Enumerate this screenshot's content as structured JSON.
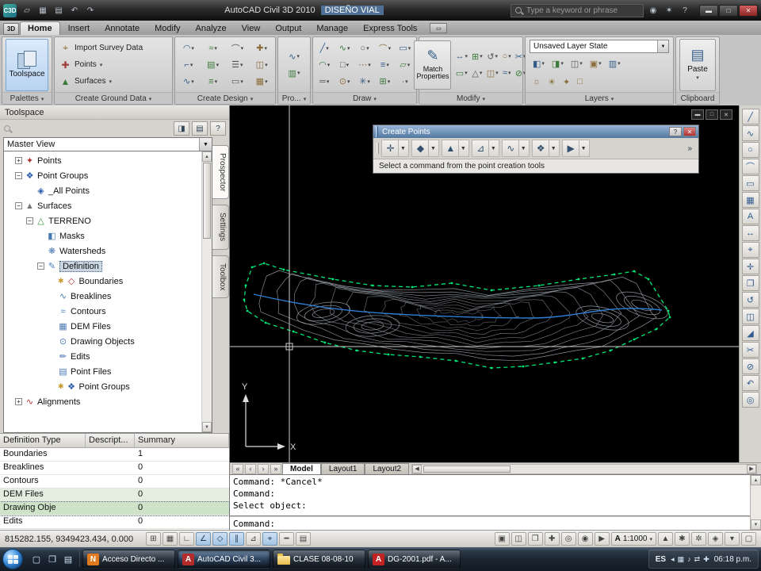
{
  "titlebar": {
    "app_title": "AutoCAD Civil 3D 2010",
    "doc_title": "DISEÑO VIAL",
    "search_placeholder": "Type a keyword or phrase",
    "quick_access": [
      {
        "name": "open-icon",
        "g": "▱"
      },
      {
        "name": "save-icon",
        "g": "▦"
      },
      {
        "name": "plot-icon",
        "g": "▤"
      },
      {
        "name": "undo-icon",
        "g": "↶"
      },
      {
        "name": "redo-icon",
        "g": "↷"
      }
    ],
    "right_icons": [
      {
        "name": "communication-center-icon",
        "g": "◉"
      },
      {
        "name": "favorites-icon",
        "g": "✶"
      },
      {
        "name": "help-icon",
        "g": "?"
      }
    ],
    "window_controls": [
      {
        "name": "minimize-button",
        "g": "▬"
      },
      {
        "name": "restore-button",
        "g": "□"
      },
      {
        "name": "close-button",
        "g": "✕"
      }
    ]
  },
  "menu": {
    "app_button": "3D",
    "tabs": [
      "Home",
      "Insert",
      "Annotate",
      "Modify",
      "Analyze",
      "View",
      "Output",
      "Manage",
      "Express Tools"
    ],
    "active_index": 0,
    "overflow_icon": "▭"
  },
  "ribbon": {
    "panels": {
      "palettes": "Palettes",
      "ground": "Create Ground Data",
      "design": "Create Design",
      "profile": "Pro...",
      "draw": "Draw",
      "modify": "Modify",
      "layers": "Layers",
      "clipboard": "Clipboard"
    },
    "toolspace_button": "Toolspace",
    "ground_buttons": [
      {
        "label": "Import Survey Data",
        "g": "⌖",
        "c": "#8a6d3b",
        "dd": false
      },
      {
        "label": "Points",
        "g": "✚",
        "c": "#a33a3a",
        "dd": true
      },
      {
        "label": "Surfaces",
        "g": "▲",
        "c": "#3a7a3a",
        "dd": true
      }
    ],
    "create_design_icons": [
      "◠",
      "≈",
      "⌒",
      "✚",
      "⌐",
      "▤",
      "☰",
      "◫",
      "∿",
      "≡",
      "▭",
      "▦"
    ],
    "profile_icons": [
      "∿",
      "▥"
    ],
    "draw_icons": [
      "╱",
      "∿",
      "○",
      "⌒",
      "▭",
      "◠",
      "□",
      "⋯",
      "≡",
      "▱",
      "═",
      "⊙",
      "✳",
      "⊞",
      "∙"
    ],
    "modify_big": "Match Properties",
    "modify_big_icon": "✎",
    "modify_icons": [
      "↔",
      "⊞",
      "↺",
      "○",
      "✂",
      "▭",
      "△",
      "◫",
      "≈",
      "⊘"
    ],
    "layers_dropdown": "Unsaved Layer State",
    "layer_tool_icons": [
      "◧",
      "◨",
      "◫",
      "▣",
      "▥"
    ],
    "layer_bulb_icons": [
      "☼",
      "☀",
      "✦",
      "□"
    ],
    "paste_button": "Paste",
    "paste_icon": "▤"
  },
  "toolspace": {
    "title": "Toolspace",
    "header_icons": [
      {
        "name": "autohide-icon",
        "g": "◨"
      },
      {
        "name": "properties-icon",
        "g": "▤"
      },
      {
        "name": "help-icon",
        "g": "?"
      }
    ],
    "view_selector": "Master View",
    "side_tabs": [
      "Prospector",
      "Settings",
      "Toolbox"
    ],
    "tree": [
      {
        "label": "Points",
        "lvl": 1,
        "exp": "+",
        "icon": "points-icon",
        "g": "✦",
        "c": "#b03030"
      },
      {
        "label": "Point Groups",
        "lvl": 1,
        "exp": "-",
        "icon": "point-groups-icon",
        "g": "❖",
        "c": "#2a5caa"
      },
      {
        "label": "_All Points",
        "lvl": 2,
        "exp": "",
        "icon": "point-group-icon",
        "g": "◈",
        "c": "#2a5caa"
      },
      {
        "label": "Surfaces",
        "lvl": 1,
        "exp": "-",
        "icon": "surfaces-icon",
        "g": "▲",
        "c": "#777777"
      },
      {
        "label": "TERRENO",
        "lvl": 2,
        "exp": "-",
        "icon": "surface-icon",
        "g": "△",
        "c": "#3a8f3a"
      },
      {
        "label": "Masks",
        "lvl": 3,
        "exp": "",
        "icon": "masks-icon",
        "g": "◧",
        "c": "#4a7ab5"
      },
      {
        "label": "Watersheds",
        "lvl": 3,
        "exp": "",
        "icon": "watersheds-icon",
        "g": "❋",
        "c": "#4a7ab5"
      },
      {
        "label": "Definition",
        "lvl": 3,
        "exp": "-",
        "icon": "definition-icon",
        "g": "✎",
        "c": "#4a7ab5",
        "sel": true
      },
      {
        "label": "Boundaries",
        "lvl": 4,
        "exp": "",
        "icon": "boundaries-icon",
        "g": "◇",
        "c": "#b03030",
        "star": true
      },
      {
        "label": "Breaklines",
        "lvl": 4,
        "exp": "",
        "icon": "breaklines-icon",
        "g": "∿",
        "c": "#4a7ab5"
      },
      {
        "label": "Contours",
        "lvl": 4,
        "exp": "",
        "icon": "contours-icon",
        "g": "≈",
        "c": "#4a7ab5"
      },
      {
        "label": "DEM Files",
        "lvl": 4,
        "exp": "",
        "icon": "dem-files-icon",
        "g": "▦",
        "c": "#4a7ab5"
      },
      {
        "label": "Drawing Objects",
        "lvl": 4,
        "exp": "",
        "icon": "drawing-objects-icon",
        "g": "⊙",
        "c": "#4a7ab5"
      },
      {
        "label": "Edits",
        "lvl": 4,
        "exp": "",
        "icon": "edits-icon",
        "g": "✏",
        "c": "#4a7ab5"
      },
      {
        "label": "Point Files",
        "lvl": 4,
        "exp": "",
        "icon": "point-files-icon",
        "g": "▤",
        "c": "#4a7ab5"
      },
      {
        "label": "Point Groups",
        "lvl": 4,
        "exp": "",
        "icon": "point-groups-icon",
        "g": "❖",
        "c": "#2a5caa",
        "star": true
      },
      {
        "label": "Alignments",
        "lvl": 1,
        "exp": "+",
        "icon": "alignments-icon",
        "g": "∿",
        "c": "#b03030"
      }
    ],
    "table": {
      "columns": [
        "Definition Type",
        "Descript...",
        "Summary"
      ],
      "rows": [
        [
          "Boundaries",
          "",
          "1"
        ],
        [
          "Breaklines",
          "",
          "0"
        ],
        [
          "Contours",
          "",
          "0"
        ],
        [
          "DEM Files",
          "",
          "0"
        ],
        [
          "Drawing Obje",
          "",
          "0"
        ],
        [
          "Edits",
          "",
          "0"
        ]
      ]
    }
  },
  "create_points": {
    "title": "Create Points",
    "hint": "Select a command from the point creation tools",
    "title_buttons": [
      {
        "name": "help-button",
        "g": "?"
      },
      {
        "name": "close-button",
        "g": "✕",
        "close": true
      }
    ],
    "tools": [
      {
        "name": "miscellaneous-points-tool",
        "g": "✛"
      },
      {
        "name": "intersection-points-tool",
        "g": "◆"
      },
      {
        "name": "surface-points-tool",
        "g": "▲"
      },
      {
        "name": "slope-points-tool",
        "g": "⊿"
      },
      {
        "name": "alignment-points-tool",
        "g": "∿"
      },
      {
        "name": "import-points-tool",
        "g": "❖"
      },
      {
        "name": "run-tool",
        "g": "▶"
      }
    ],
    "more_icon": "»"
  },
  "canvas": {
    "window_controls": [
      {
        "name": "minimize-drawing-button",
        "g": "▬"
      },
      {
        "name": "restore-drawing-button",
        "g": "□"
      },
      {
        "name": "close-drawing-button",
        "g": "✕"
      }
    ],
    "ucs": {
      "x": "X",
      "y": "Y"
    }
  },
  "right_toolbar": {
    "icons": [
      {
        "name": "line-icon",
        "g": "╱"
      },
      {
        "name": "polyline-icon",
        "g": "∿"
      },
      {
        "name": "circle-icon",
        "g": "○"
      },
      {
        "name": "arc-icon",
        "g": "⌒"
      },
      {
        "name": "rectangle-icon",
        "g": "▭"
      },
      {
        "name": "hatch-icon",
        "g": "▦"
      },
      {
        "name": "text-icon",
        "g": "A"
      },
      {
        "name": "dimension-icon",
        "g": "↔"
      },
      {
        "name": "measure-icon",
        "g": "⌖"
      },
      {
        "name": "move-icon",
        "g": "✛"
      },
      {
        "name": "copy-icon",
        "g": "❐"
      },
      {
        "name": "rotate-icon",
        "g": "↺"
      },
      {
        "name": "mirror-icon",
        "g": "◫"
      },
      {
        "name": "scale-icon",
        "g": "◢"
      },
      {
        "name": "trim-icon",
        "g": "✂"
      },
      {
        "name": "erase-icon",
        "g": "⊘"
      },
      {
        "name": "undo-icon",
        "g": "↶"
      },
      {
        "name": "zoom-icon",
        "g": "◎"
      }
    ]
  },
  "layout_bar": {
    "tabs": [
      "Model",
      "Layout1",
      "Layout2"
    ],
    "active_index": 0
  },
  "command": {
    "history": [
      "Command: *Cancel*",
      "Command:",
      "Select object:"
    ],
    "prompt": "Command:"
  },
  "status": {
    "coords": "815282.155, 9349423.434, 0.000",
    "toggles": [
      {
        "name": "snap-toggle",
        "g": "⊞",
        "on": false
      },
      {
        "name": "grid-toggle",
        "g": "▦",
        "on": false
      },
      {
        "name": "ortho-toggle",
        "g": "∟",
        "on": false
      },
      {
        "name": "polar-toggle",
        "g": "∠",
        "on": true
      },
      {
        "name": "osnap-toggle",
        "g": "◇",
        "on": true
      },
      {
        "name": "otrack-toggle",
        "g": "∥",
        "on": true
      },
      {
        "name": "ducs-toggle",
        "g": "⊿",
        "on": false
      },
      {
        "name": "dyn-toggle",
        "g": "⌖",
        "on": true
      },
      {
        "name": "lwt-toggle",
        "g": "━",
        "on": false
      },
      {
        "name": "qp-toggle",
        "g": "▤",
        "on": false
      }
    ],
    "right_icons": [
      {
        "name": "model-button",
        "g": "▣"
      },
      {
        "name": "quick-view-layouts-icon",
        "g": "◫"
      },
      {
        "name": "quick-view-drawings-icon",
        "g": "❐"
      },
      {
        "name": "pan-icon",
        "g": "✚"
      },
      {
        "name": "zoom-icon",
        "g": "◎"
      },
      {
        "name": "steering-wheel-icon",
        "g": "◉"
      },
      {
        "name": "showmotion-icon",
        "g": "▶"
      }
    ],
    "annotation_letter": "A",
    "annotation_scale": "1:1000",
    "right_icons2": [
      {
        "name": "annotation-visibility-icon",
        "g": "▲"
      },
      {
        "name": "annotation-autoscale-icon",
        "g": "✱"
      },
      {
        "name": "workspace-gear-icon",
        "g": "✲"
      },
      {
        "name": "toolbar-lock-icon",
        "g": "◈"
      },
      {
        "name": "status-menu-arrow-icon",
        "g": "▾"
      },
      {
        "name": "clean-screen-icon",
        "g": "▢"
      }
    ]
  },
  "taskbar": {
    "quick_launch": [
      {
        "name": "show-desktop-icon",
        "g": "▢"
      },
      {
        "name": "window-switcher-icon",
        "g": "❐"
      },
      {
        "name": "explorer-icon",
        "g": "▤"
      }
    ],
    "items": [
      {
        "label": "Acceso Directo ...",
        "icon": "shortcut-icon",
        "ic": "#e07a1f",
        "letter": "N",
        "active": false
      },
      {
        "label": "AutoCAD Civil 3...",
        "icon": "autocad-icon",
        "ic": "#b32b2b",
        "letter": "A",
        "active": true
      },
      {
        "label": "CLASE 08-08-10",
        "icon": "folder-icon",
        "ic": "",
        "letter": "",
        "active": false
      },
      {
        "label": "DG-2001.pdf - A...",
        "icon": "pdf-icon",
        "ic": "#c22222",
        "letter": "A",
        "active": false
      }
    ],
    "tray": {
      "lang": "ES",
      "icons": [
        {
          "name": "hidden-icons-icon",
          "g": "◂"
        },
        {
          "name": "language-bar-icon",
          "g": "▦"
        },
        {
          "name": "volume-icon",
          "g": "♪"
        },
        {
          "name": "network-icon",
          "g": "⇄"
        },
        {
          "name": "security-icon",
          "g": "✚"
        }
      ],
      "time": "06:18 p.m."
    }
  }
}
